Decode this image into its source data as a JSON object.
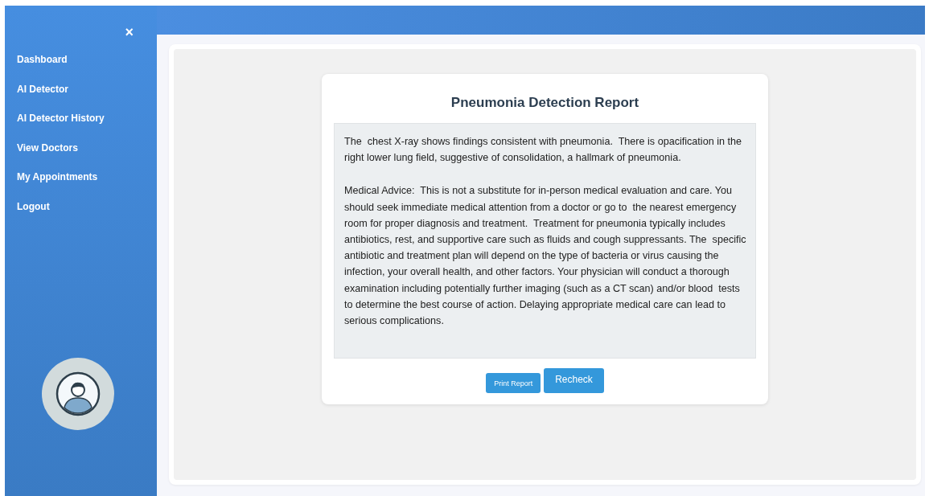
{
  "sidebar": {
    "close": "×",
    "items": [
      "Dashboard",
      "AI Detector",
      "AI Detector History",
      "View Doctors",
      "My Appointments",
      "Logout"
    ]
  },
  "report": {
    "title": "Pneumonia Detection Report",
    "paragraphs": [
      "The  chest X-ray shows findings consistent with pneumonia.  There is opacification in the right lower lung field, suggestive of consolidation, a hallmark of pneumonia.",
      "Medical Advice:  This is not a substitute for in-person medical evaluation and care. You should seek immediate medical attention from a doctor or go to  the nearest emergency room for proper diagnosis and treatment.  Treatment for pneumonia typically includes antibiotics, rest, and supportive care such as fluids and cough suppressants. The  specific antibiotic and treatment plan will depend on the type of bacteria or virus causing the infection, your overall health, and other factors. Your physician will conduct a thorough examination including potentially further imaging (such as a CT scan) and/or blood  tests to determine the best course of action. Delaying appropriate medical care can lead to serious complications."
    ],
    "buttons": [
      {
        "label": "Print Report",
        "kind": "small"
      },
      {
        "label": "Recheck",
        "kind": "large"
      }
    ]
  }
}
